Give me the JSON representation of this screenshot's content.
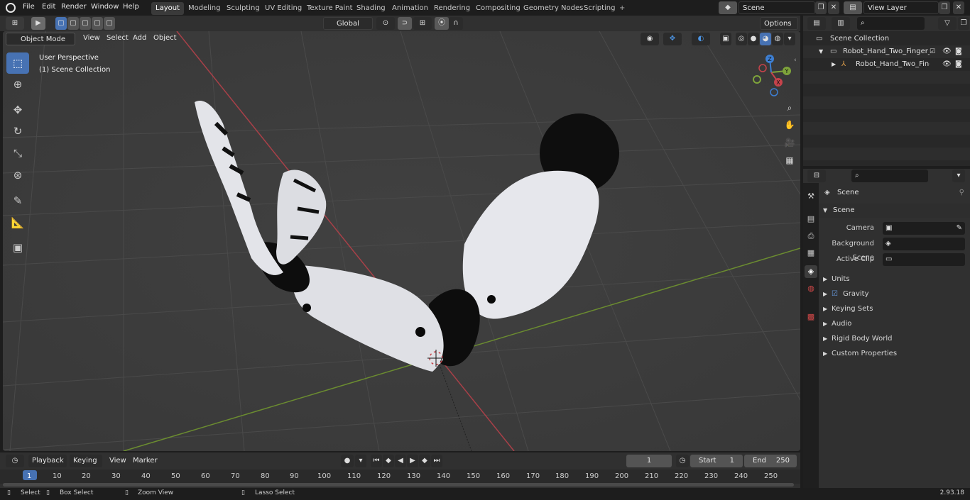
{
  "topbar": {
    "menus": [
      "File",
      "Edit",
      "Render",
      "Window",
      "Help"
    ],
    "workspaces": [
      "Layout",
      "Modeling",
      "Sculpting",
      "UV Editing",
      "Texture Paint",
      "Shading",
      "Animation",
      "Rendering",
      "Compositing",
      "Geometry Nodes",
      "Scripting"
    ],
    "active_workspace": "Layout",
    "add_tab": "+",
    "scene_name": "Scene",
    "view_layer": "View Layer"
  },
  "toolheader": {
    "orientation": "Global",
    "options": "Options"
  },
  "viewport_header": {
    "mode": "Object Mode",
    "menus": [
      "View",
      "Select",
      "Add",
      "Object"
    ]
  },
  "viewport": {
    "perspective_label": "User Perspective",
    "collection_label": "(1) Scene Collection",
    "gizmo_axes": {
      "x": "X",
      "y": "Y",
      "z": "Z"
    },
    "colors": {
      "x_axis": "#c6434b",
      "y_axis": "#7ea33b",
      "z_axis": "#3d7fd3",
      "active_tool": "#4772b3"
    }
  },
  "outliner": {
    "root": "Scene Collection",
    "items": [
      "Robot_Hand_Two_Finger_Pos",
      "Robot_Hand_Two_Finger"
    ]
  },
  "properties": {
    "header": "Scene",
    "section": "Scene",
    "fields": [
      {
        "label": "Camera",
        "value": ""
      },
      {
        "label": "Background Scene",
        "value": ""
      },
      {
        "label": "Active Clip",
        "value": ""
      }
    ],
    "panels": [
      "Units",
      "Gravity",
      "Keying Sets",
      "Audio",
      "Rigid Body World",
      "Custom Properties"
    ]
  },
  "timeline": {
    "menus": [
      "Playback",
      "Keying",
      "View",
      "Marker"
    ],
    "current_frame": "1",
    "start_label": "Start",
    "start_value": "1",
    "end_label": "End",
    "end_value": "250",
    "ruler": [
      "1",
      "10",
      "20",
      "30",
      "40",
      "50",
      "60",
      "70",
      "80",
      "90",
      "100",
      "110",
      "120",
      "130",
      "140",
      "150",
      "160",
      "170",
      "180",
      "190",
      "200",
      "210",
      "220",
      "230",
      "240",
      "250"
    ]
  },
  "statusbar": {
    "items": [
      "Select",
      "Box Select",
      "Zoom View",
      "Lasso Select"
    ],
    "version": "2.93.18"
  }
}
